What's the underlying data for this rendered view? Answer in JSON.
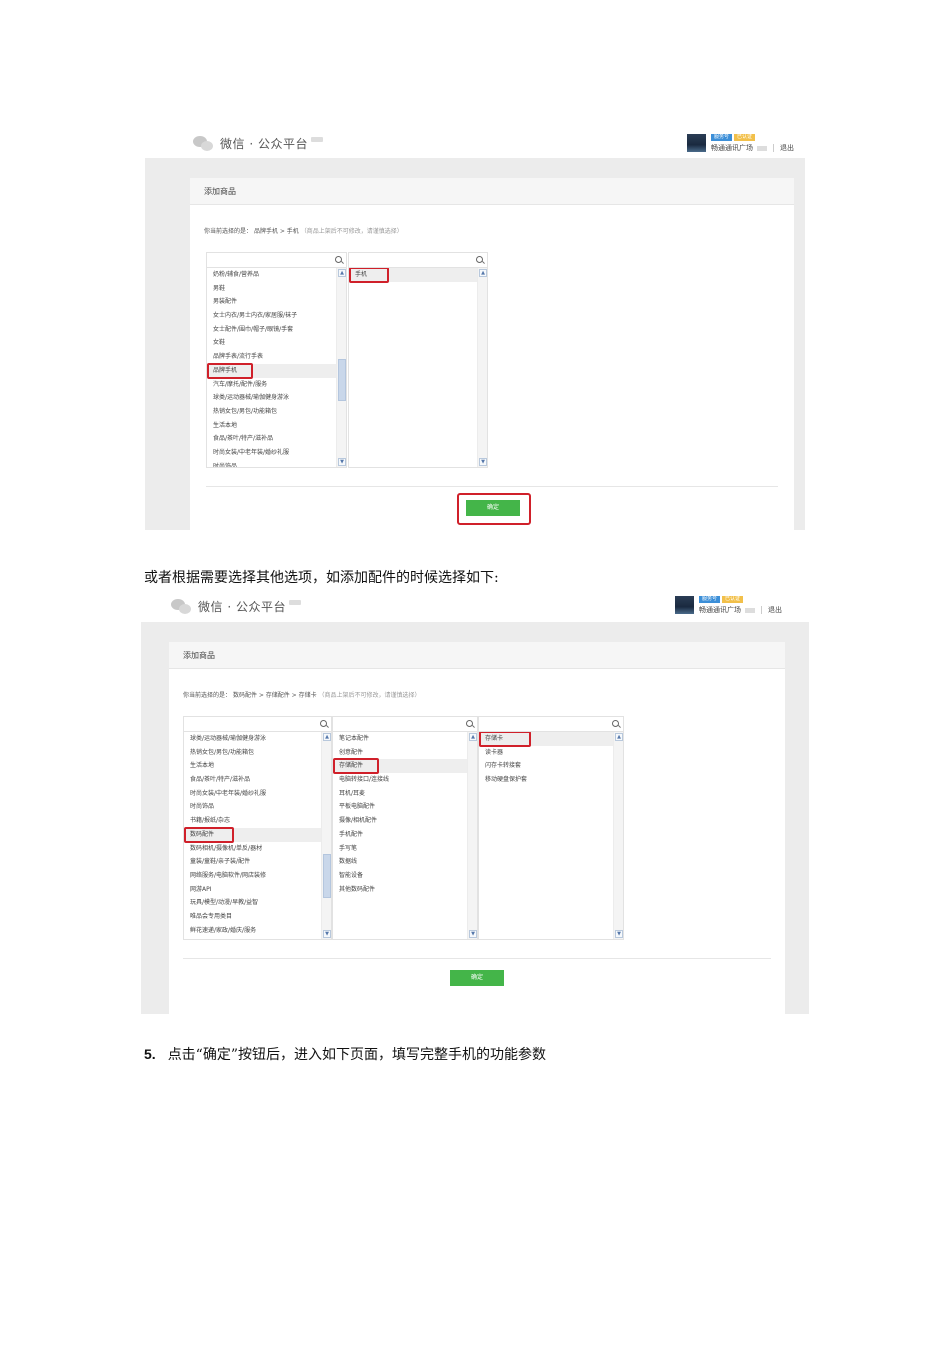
{
  "shot1": {
    "logo_text": "微信 · 公众平台",
    "account": {
      "badge_blue": "服务号",
      "badge_yellow": "已认证",
      "name": "畅通通讯广场",
      "logout": "退出"
    },
    "panel_title": "添加商品",
    "crumb_prefix": "你当前选择的是：",
    "crumb_path": "品牌手机 > 手机",
    "crumb_note": "（商品上架后不可修改，请谨慎选择）",
    "col1_items": [
      "奶粉/辅食/营养品",
      "男鞋",
      "男装配件",
      "女士内衣/男士内衣/家居服/袜子",
      "女士配件/围巾/帽子/眼镜/手套",
      "女鞋",
      "品牌手表/流行手表",
      "品牌手机",
      "汽车/摩托/配件/服务",
      "球类/运动器械/瑜伽健身游泳",
      "热销女包/男包/功能箱包",
      "生活本地",
      "食品/茶叶/特产/滋补品",
      "时尚女装/中老年装/婚纱礼服",
      "时尚饰品"
    ],
    "col1_selected": 7,
    "col2_items": [
      "手机"
    ],
    "col2_selected": 0,
    "confirm": "确定"
  },
  "between_text": "或者根据需要选择其他选项，如添加配件的时候选择如下:",
  "shot2": {
    "logo_text": "微信 · 公众平台",
    "account": {
      "badge_blue": "服务号",
      "badge_yellow": "已认证",
      "name": "畅通通讯广场",
      "logout": "退出"
    },
    "panel_title": "添加商品",
    "crumb_prefix": "你当前选择的是：",
    "crumb_path": "数码配件 > 存储配件 > 存储卡",
    "crumb_note": "（商品上架后不可修改，请谨慎选择）",
    "col1_items": [
      "球类/运动器械/瑜伽健身游泳",
      "热销女包/男包/功能箱包",
      "生活本地",
      "食品/茶叶/特产/滋补品",
      "时尚女装/中老年装/婚纱礼服",
      "时尚饰品",
      "书籍/报纸/杂志",
      "数码配件",
      "数码相机/摄像机/单反/器材",
      "童装/童鞋/亲子装/配件",
      "网络服务/电脑软件/网店装修",
      "网游API",
      "玩具/模型/动漫/早教/益智",
      "唯品会专用类目",
      "鲜花速递/家政/婚庆/服务"
    ],
    "col1_selected": 7,
    "col2_items": [
      "笔记本配件",
      "创意配件",
      "存储配件",
      "电脑转接口/连接线",
      "耳机/耳麦",
      "平板电脑配件",
      "摄像/相机配件",
      "手机配件",
      "手写笔",
      "数据线",
      "智能设备",
      "其他数码配件"
    ],
    "col2_selected": 2,
    "col3_items": [
      "存储卡",
      "读卡器",
      "闪存卡转接套",
      "移动硬盘保护套"
    ],
    "col3_selected": 0,
    "confirm": "确定"
  },
  "step": {
    "number": "5.",
    "text": "点击“确定”按钮后，进入如下页面，填写完整手机的功能参数"
  },
  "colors": {
    "confirm_green": "#44b549",
    "highlight_red": "#d0202a",
    "badge_blue": "#3c8fd8",
    "badge_yellow": "#f2c04a"
  }
}
